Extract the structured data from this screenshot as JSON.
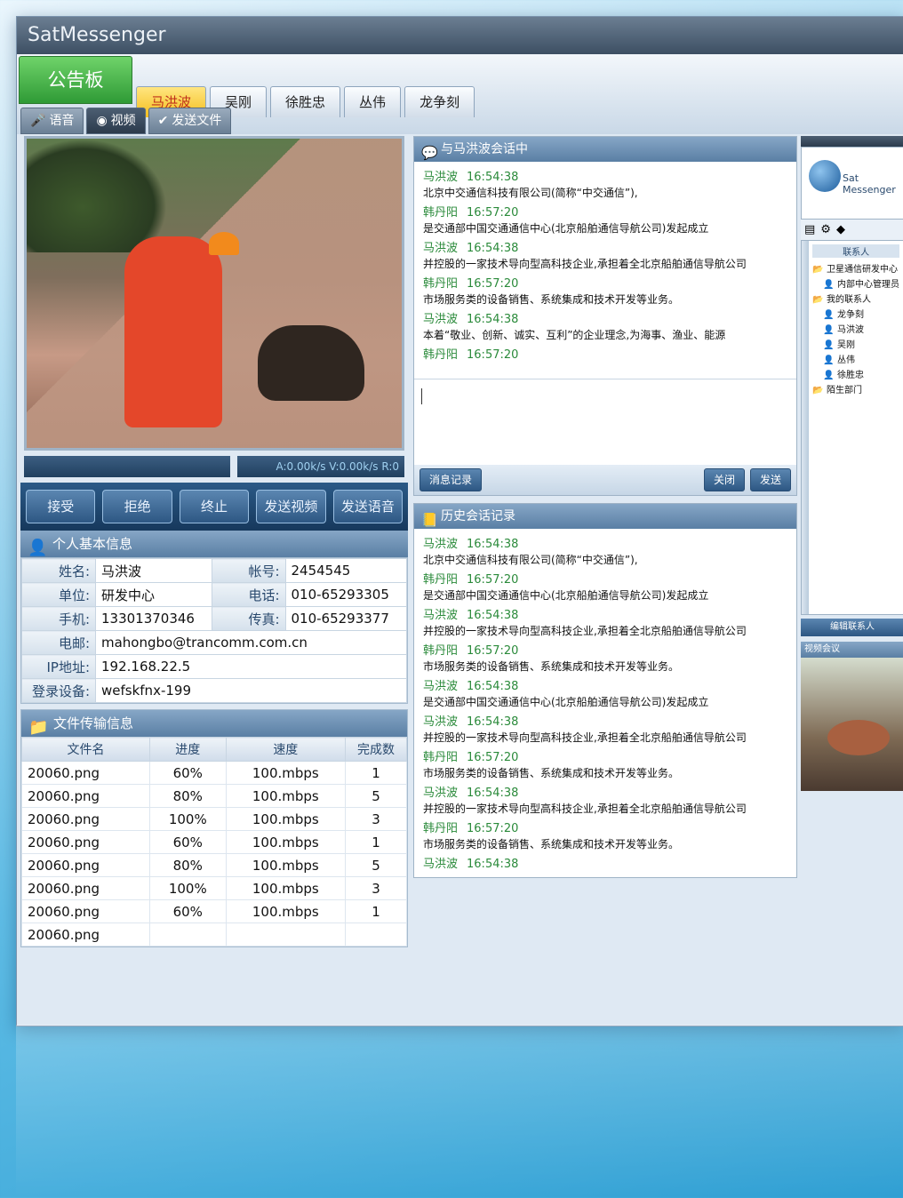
{
  "window": {
    "title": "SatMessenger"
  },
  "tabs": {
    "board": "公告板",
    "contacts": [
      "马洪波",
      "吴刚",
      "徐胜忠",
      "丛伟",
      "龙争刻"
    ],
    "modes": [
      "语音",
      "视频",
      "发送文件"
    ]
  },
  "video": {
    "status_text": "A:0.00k/s V:0.00k/s R:0"
  },
  "actions": [
    "接受",
    "拒绝",
    "终止",
    "发送视频",
    "发送语音"
  ],
  "profile": {
    "header": "个人基本信息",
    "rows": [
      {
        "label": "姓名:",
        "value": "马洪波",
        "label2": "帐号:",
        "value2": "2454545"
      },
      {
        "label": "单位:",
        "value": "研发中心",
        "label2": "电话:",
        "value2": "010-65293305"
      },
      {
        "label": "手机:",
        "value": "13301370346",
        "label2": "传真:",
        "value2": "010-65293377"
      },
      {
        "label": "电邮:",
        "value": "mahongbo@trancomm.com.cn"
      },
      {
        "label": "IP地址:",
        "value": "192.168.22.5"
      },
      {
        "label": "登录设备:",
        "value": "wefskfnx-199"
      }
    ]
  },
  "files": {
    "header": "文件传输信息",
    "columns": [
      "文件名",
      "进度",
      "速度",
      "完成数"
    ],
    "rows": [
      [
        "20060.png",
        "60%",
        "100.mbps",
        "1"
      ],
      [
        "20060.png",
        "80%",
        "100.mbps",
        "5"
      ],
      [
        "20060.png",
        "100%",
        "100.mbps",
        "3"
      ],
      [
        "20060.png",
        "60%",
        "100.mbps",
        "1"
      ],
      [
        "20060.png",
        "80%",
        "100.mbps",
        "5"
      ],
      [
        "20060.png",
        "100%",
        "100.mbps",
        "3"
      ],
      [
        "20060.png",
        "60%",
        "100.mbps",
        "1"
      ],
      [
        "20060.png",
        "",
        "",
        ""
      ]
    ]
  },
  "chat": {
    "header": "与马洪波会话中",
    "messages": [
      {
        "who": "马洪波",
        "time": "16:54:38",
        "text": "北京中交通信科技有限公司(简称“中交通信”),"
      },
      {
        "who": "韩丹阳",
        "time": "16:57:20",
        "text": "是交通部中国交通通信中心(北京船舶通信导航公司)发起成立"
      },
      {
        "who": "马洪波",
        "time": "16:54:38",
        "text": "并控股的一家技术导向型高科技企业,承担着全北京船舶通信导航公司"
      },
      {
        "who": "韩丹阳",
        "time": "16:57:20",
        "text": "市场服务类的设备销售、系统集成和技术开发等业务。"
      },
      {
        "who": "马洪波",
        "time": "16:54:38",
        "text": "本着“敬业、创新、诚实、互利”的企业理念,为海事、渔业、能源"
      },
      {
        "who": "韩丹阳",
        "time": "16:57:20",
        "text": ""
      }
    ],
    "history_btn": "消息记录",
    "close_btn": "关闭",
    "send_btn": "发送"
  },
  "history": {
    "header": "历史会话记录",
    "messages": [
      {
        "who": "马洪波",
        "time": "16:54:38",
        "text": "北京中交通信科技有限公司(简称“中交通信”),"
      },
      {
        "who": "韩丹阳",
        "time": "16:57:20",
        "text": "是交通部中国交通通信中心(北京船舶通信导航公司)发起成立"
      },
      {
        "who": "马洪波",
        "time": "16:54:38",
        "text": "并控股的一家技术导向型高科技企业,承担着全北京船舶通信导航公司"
      },
      {
        "who": "韩丹阳",
        "time": "16:57:20",
        "text": "市场服务类的设备销售、系统集成和技术开发等业务。"
      },
      {
        "who": "马洪波",
        "time": "16:54:38",
        "text": "是交通部中国交通通信中心(北京船舶通信导航公司)发起成立"
      },
      {
        "who": "马洪波",
        "time": "16:54:38",
        "text": "并控股的一家技术导向型高科技企业,承担着全北京船舶通信导航公司"
      },
      {
        "who": "韩丹阳",
        "time": "16:57:20",
        "text": "市场服务类的设备销售、系统集成和技术开发等业务。"
      },
      {
        "who": "马洪波",
        "time": "16:54:38",
        "text": "并控股的一家技术导向型高科技企业,承担着全北京船舶通信导航公司"
      },
      {
        "who": "韩丹阳",
        "time": "16:57:20",
        "text": "市场服务类的设备销售、系统集成和技术开发等业务。"
      },
      {
        "who": "马洪波",
        "time": "16:54:38",
        "text": ""
      }
    ]
  },
  "sidebar": {
    "logo_text": "Sat Messenger",
    "tree_header": "联系人",
    "groups": [
      {
        "name": "卫星通信研发中心",
        "items": [
          "内部中心管理员"
        ]
      },
      {
        "name": "我的联系人",
        "items": [
          "龙争刻",
          "马洪波",
          "吴刚",
          "丛伟",
          "徐胜忠"
        ]
      },
      {
        "name": "陌生部门",
        "items": []
      }
    ],
    "bottom_btn": "编辑联系人",
    "video_header": "视频会议"
  }
}
